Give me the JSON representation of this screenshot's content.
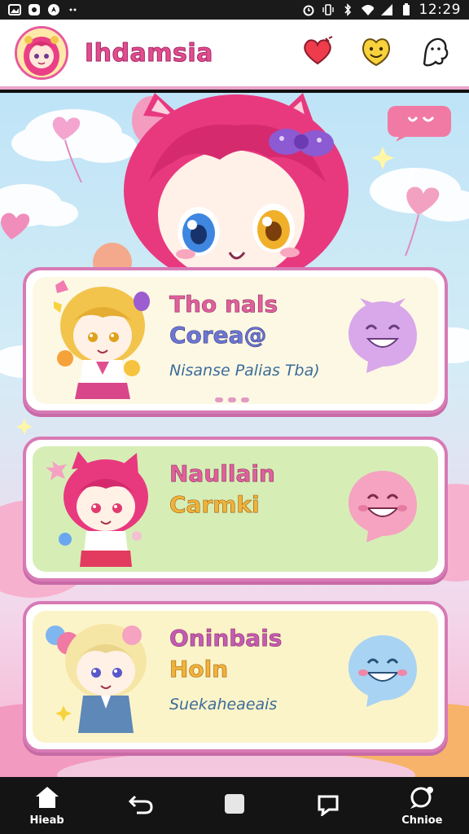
{
  "status_bar": {
    "time": "12:29"
  },
  "header": {
    "app_title": "Ihdamsia"
  },
  "cards": [
    {
      "line1": "Tho nals",
      "line2": "Corea@",
      "line3": "Nisanse Palias Tba)"
    },
    {
      "line1": "Naullain",
      "line2": "Carmki",
      "line3": ""
    },
    {
      "line1": "Oninbais",
      "line2": "Holn",
      "line3": "Suekaheaeais"
    }
  ],
  "nav": {
    "home_label": "Hieab",
    "chat_label": "Chnioe"
  },
  "colors": {
    "accent_pink": "#e14d8f",
    "card_border": "#d77ab5",
    "sky": "#bfe4f7"
  },
  "icons": {
    "header": [
      "heart-icon",
      "smiley-icon",
      "ghost-icon"
    ],
    "nav": [
      "home-icon",
      "back-icon",
      "square-icon",
      "recents-icon",
      "chat-icon"
    ]
  }
}
